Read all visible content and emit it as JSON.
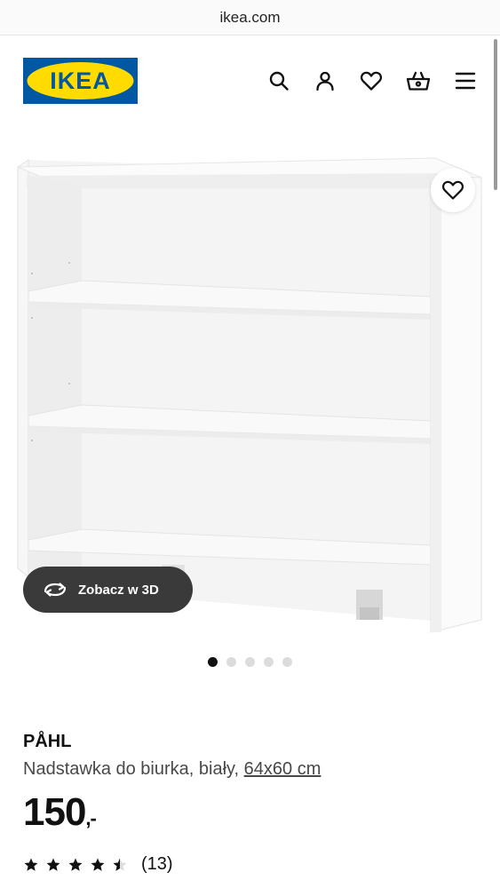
{
  "browser": {
    "url": "ikea.com"
  },
  "header": {
    "logo_text": "IKEA",
    "icons": [
      "search-icon",
      "user-icon",
      "heart-icon",
      "basket-icon",
      "menu-icon"
    ]
  },
  "gallery": {
    "view3d_label": "Zobacz w 3D",
    "image_count": 5,
    "active_image": 1
  },
  "product": {
    "name": "PÅHL",
    "description": "Nadstawka do biurka, biały, ",
    "size_link": "64x60 cm",
    "price_main": "150",
    "price_suffix": ",-",
    "rating": 4.5,
    "rating_max": 5,
    "review_count": "(13)"
  },
  "colors": {
    "ikea_blue": "#0058a3",
    "ikea_yellow": "#ffdb00",
    "pill_bg": "#3a3a3a"
  }
}
